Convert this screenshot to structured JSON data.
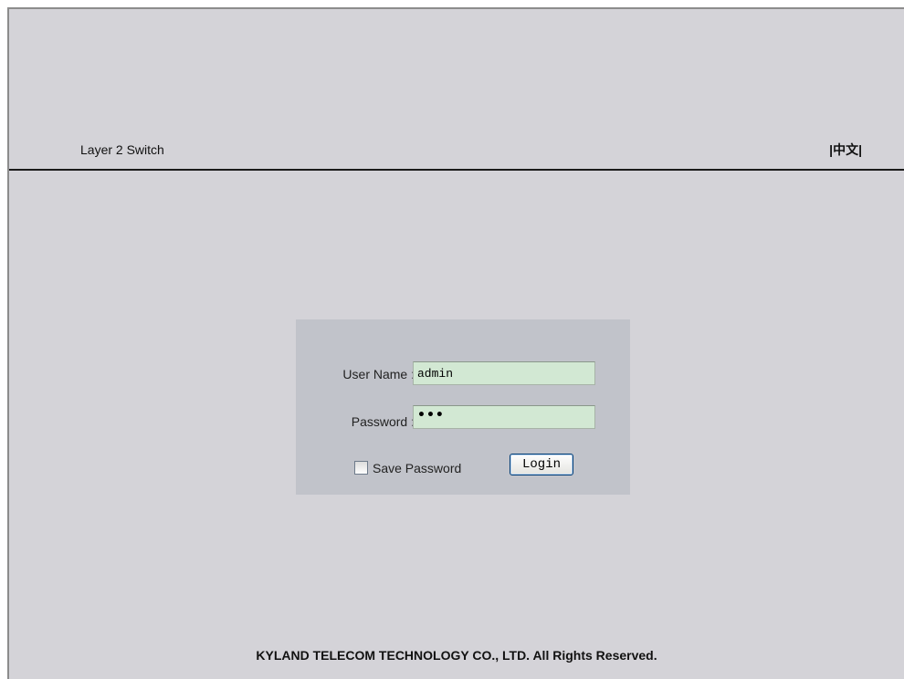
{
  "header": {
    "title": "Layer 2 Switch",
    "language_link": "|中文|"
  },
  "login": {
    "username_label": "User Name :",
    "username_value": "admin",
    "password_label": "Password :",
    "password_masked": "•••",
    "save_password_label": "Save Password",
    "save_password_checked": false,
    "login_button": "Login"
  },
  "footer": {
    "copyright": "KYLAND TELECOM TECHNOLOGY CO., LTD. All Rights Reserved."
  }
}
